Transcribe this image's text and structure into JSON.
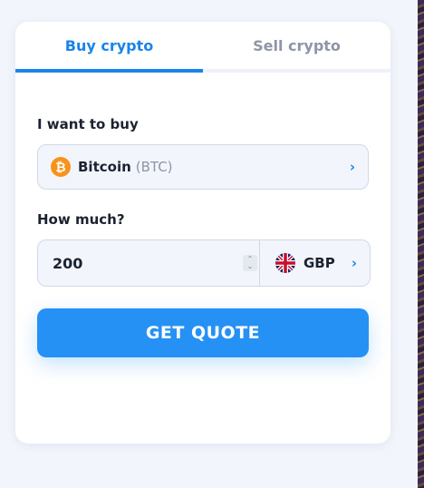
{
  "tabs": [
    {
      "label": "Buy crypto",
      "active": true
    },
    {
      "label": "Sell crypto",
      "active": false
    }
  ],
  "buy": {
    "label": "I want to buy",
    "crypto": {
      "name": "Bitcoin",
      "ticker": "(BTC)",
      "icon": "bitcoin-icon",
      "icon_glyph": "₿",
      "icon_color": "#f7931a"
    }
  },
  "amount": {
    "label": "How much?",
    "value": "200",
    "currency": "GBP",
    "currency_icon": "uk-flag-icon"
  },
  "cta": {
    "label": "GET QUOTE"
  },
  "colors": {
    "accent": "#1a85e8",
    "button": "#2591f5",
    "background": "#f2f5fb"
  }
}
